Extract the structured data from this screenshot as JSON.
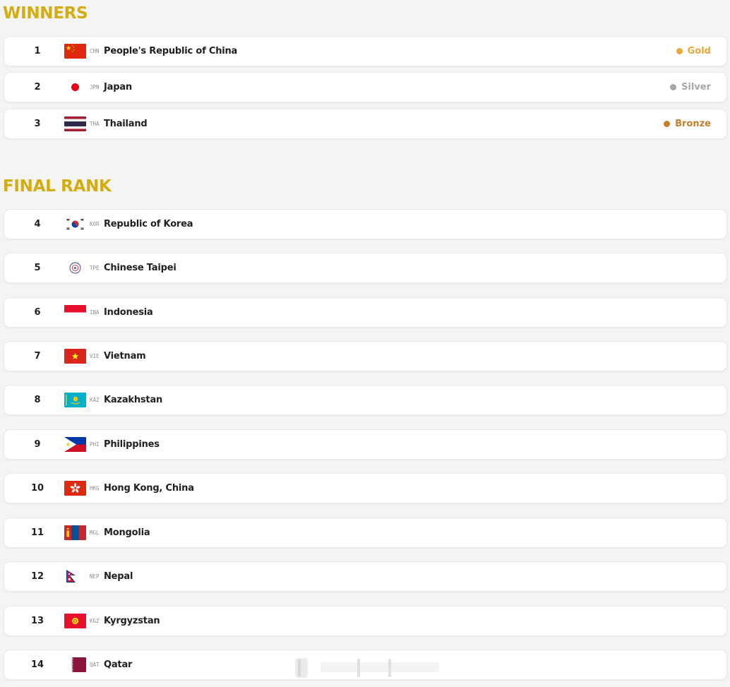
{
  "winners": {
    "title": "WINNERS",
    "title_color": "#d4ac0d",
    "rows": [
      {
        "rank": "1",
        "code": "CHN",
        "country": "People's Republic of China",
        "flag": "china",
        "medal": "Gold",
        "medal_color": "#e8a93a"
      },
      {
        "rank": "2",
        "code": "JPN",
        "country": "Japan",
        "flag": "japan",
        "medal": "Silver",
        "medal_color": "#a7a7a7"
      },
      {
        "rank": "3",
        "code": "THA",
        "country": "Thailand",
        "flag": "thailand",
        "medal": "Bronze",
        "medal_color": "#c77d29"
      }
    ]
  },
  "final_rank": {
    "title": "FINAL RANK",
    "title_color": "#d4ac0d",
    "rows": [
      {
        "rank": "4",
        "code": "KOR",
        "country": "Republic of Korea",
        "flag": "korea"
      },
      {
        "rank": "5",
        "code": "TPE",
        "country": "Chinese Taipei",
        "flag": "taipei"
      },
      {
        "rank": "6",
        "code": "INA",
        "country": "Indonesia",
        "flag": "indonesia"
      },
      {
        "rank": "7",
        "code": "VIE",
        "country": "Vietnam",
        "flag": "vietnam"
      },
      {
        "rank": "8",
        "code": "KAZ",
        "country": "Kazakhstan",
        "flag": "kazakhstan"
      },
      {
        "rank": "9",
        "code": "PHI",
        "country": "Philippines",
        "flag": "philippines"
      },
      {
        "rank": "10",
        "code": "HKG",
        "country": "Hong Kong, China",
        "flag": "hongkong"
      },
      {
        "rank": "11",
        "code": "MGL",
        "country": "Mongolia",
        "flag": "mongolia"
      },
      {
        "rank": "12",
        "code": "NEP",
        "country": "Nepal",
        "flag": "nepal"
      },
      {
        "rank": "13",
        "code": "KGZ",
        "country": "Kyrgyzstan",
        "flag": "kyrgyzstan"
      },
      {
        "rank": "14",
        "code": "QAT",
        "country": "Qatar",
        "flag": "qatar"
      }
    ]
  }
}
